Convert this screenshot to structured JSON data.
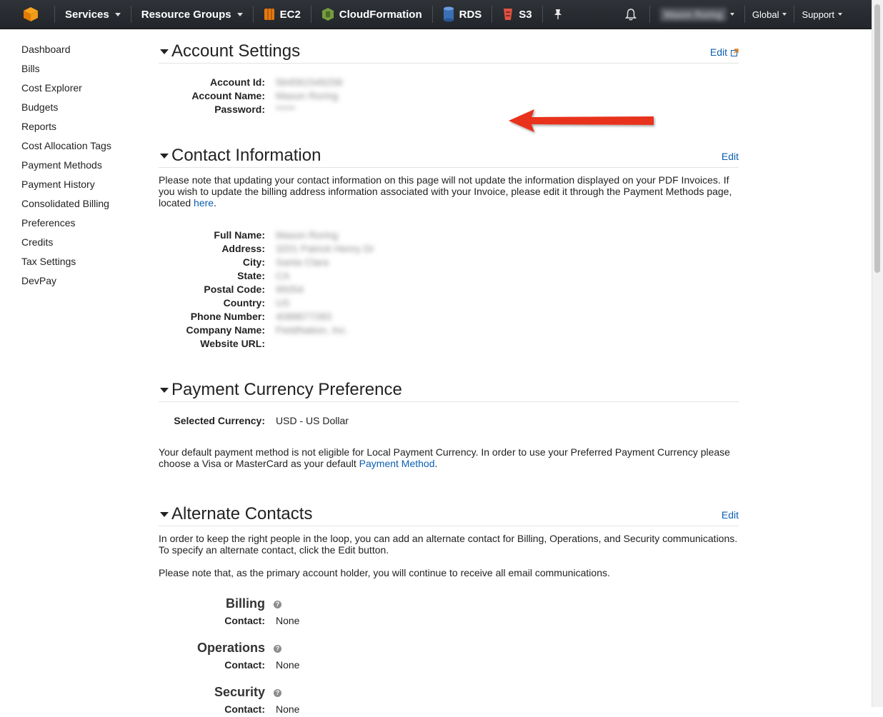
{
  "nav": {
    "services": "Services",
    "resource_groups": "Resource Groups",
    "shortcuts": [
      {
        "label": "EC2",
        "icon": "ec2-icon",
        "color": "#e47911"
      },
      {
        "label": "CloudFormation",
        "icon": "cloudformation-icon",
        "color": "#759c3e"
      },
      {
        "label": "RDS",
        "icon": "rds-icon",
        "color": "#3b6fb6"
      },
      {
        "label": "S3",
        "icon": "s3-icon",
        "color": "#e05243"
      }
    ],
    "account_name": "Mason Roring",
    "region": "Global",
    "support": "Support"
  },
  "sidebar": {
    "items": [
      "Dashboard",
      "Bills",
      "Cost Explorer",
      "Budgets",
      "Reports",
      "Cost Allocation Tags",
      "Payment Methods",
      "Payment History",
      "Consolidated Billing",
      "Preferences",
      "Credits",
      "Tax Settings",
      "DevPay"
    ]
  },
  "account_settings": {
    "title": "Account Settings",
    "edit": "Edit",
    "fields": [
      {
        "label": "Account Id:",
        "value": "564561549258"
      },
      {
        "label": "Account Name:",
        "value": "Mason Roring"
      },
      {
        "label": "Password:",
        "value": "*****"
      }
    ]
  },
  "contact_info": {
    "title": "Contact Information",
    "edit": "Edit",
    "note": "Please note that updating your contact information on this page will not update the information displayed on your PDF Invoices. If you wish to update the billing address information associated with your Invoice, please edit it through the Payment Methods page, located ",
    "note_link": "here",
    "note_end": ".",
    "fields": [
      {
        "label": "Full Name:",
        "value": "Mason Roring"
      },
      {
        "label": "Address:",
        "value": "3201 Patrick Henry Dr"
      },
      {
        "label": "City:",
        "value": "Santa Clara"
      },
      {
        "label": "State:",
        "value": "CA"
      },
      {
        "label": "Postal Code:",
        "value": "95054"
      },
      {
        "label": "Country:",
        "value": "US"
      },
      {
        "label": "Phone Number:",
        "value": "4088677283"
      },
      {
        "label": "Company Name:",
        "value": "FieldNation, Inc."
      },
      {
        "label": "Website URL:",
        "value": ""
      }
    ]
  },
  "currency": {
    "title": "Payment Currency Preference",
    "label": "Selected Currency:",
    "value": "USD - US Dollar",
    "note": "Your default payment method is not eligible for Local Payment Currency. In order to use your Preferred Payment Currency please choose a Visa or MasterCard as your default ",
    "note_link": "Payment Method",
    "note_end": "."
  },
  "alternate": {
    "title": "Alternate Contacts",
    "edit": "Edit",
    "intro": "In order to keep the right people in the loop, you can add an alternate contact for Billing, Operations, and Security communications. To specify an alternate contact, click the Edit button.",
    "note": "Please note that, as the primary account holder, you will continue to receive all email communications.",
    "groups": [
      {
        "title": "Billing",
        "contact_label": "Contact:",
        "contact_value": "None"
      },
      {
        "title": "Operations",
        "contact_label": "Contact:",
        "contact_value": "None"
      },
      {
        "title": "Security",
        "contact_label": "Contact:",
        "contact_value": "None"
      }
    ]
  },
  "colors": {
    "nav_bg": "#2a2d32",
    "link": "#0b5fb0",
    "arrow": "#e8321f"
  }
}
